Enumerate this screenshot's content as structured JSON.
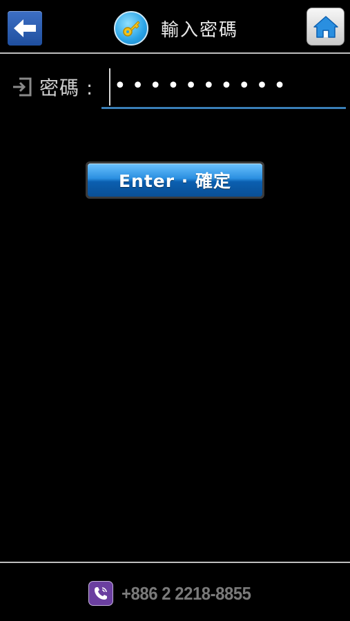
{
  "header": {
    "title": "輸入密碼",
    "back_icon": "arrow-left-icon",
    "title_icon": "key-icon",
    "home_icon": "home-icon"
  },
  "password": {
    "label": "密碼 :",
    "masked_value": "••••••••••",
    "label_icon": "login-icon"
  },
  "enter_button": {
    "label": "Enter · 確定"
  },
  "footer": {
    "phone": "+886 2 2218-8855",
    "phone_icon": "viber-icon"
  },
  "colors": {
    "background": "#000000",
    "accent_blue": "#2a8fe0",
    "underline": "#3a7fb8",
    "viber_purple": "#6b3fa0"
  }
}
